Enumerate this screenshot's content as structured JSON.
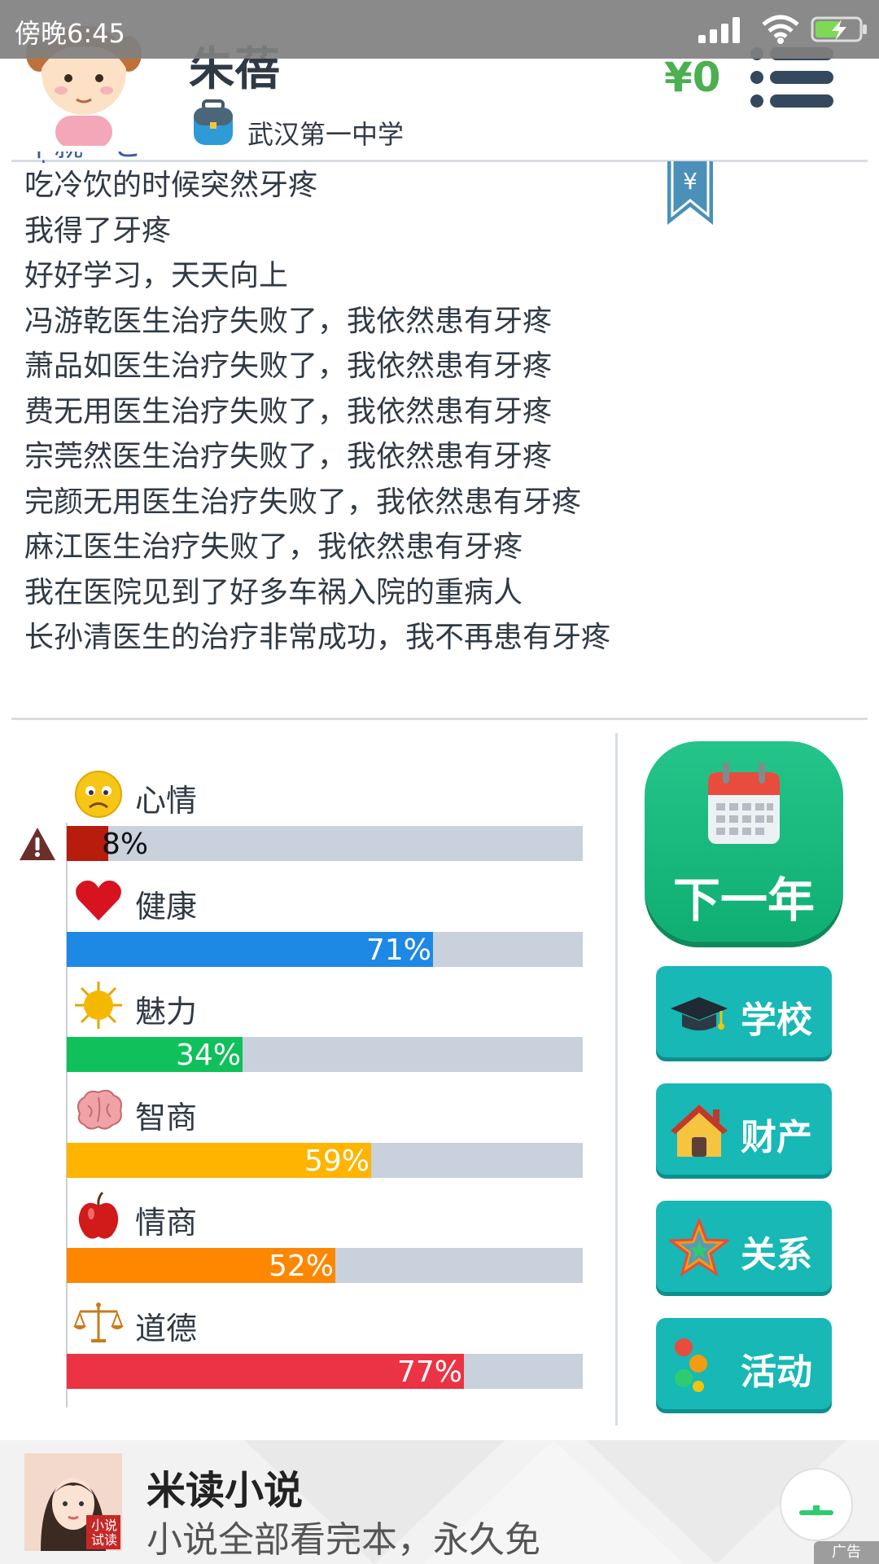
{
  "status_bar": {
    "time": "傍晚6:45"
  },
  "player": {
    "name": "朱蓓",
    "school": "武汉第一中学",
    "money": "¥0"
  },
  "log": {
    "cut_line": "中就「と吵",
    "lines": [
      "吃冷饮的时候突然牙疼",
      "我得了牙疼",
      "好好学习，天天向上",
      "冯游乾医生治疗失败了，我依然患有牙疼",
      "萧品如医生治疗失败了，我依然患有牙疼",
      "费无用医生治疗失败了，我依然患有牙疼",
      "宗莞然医生治疗失败了，我依然患有牙疼",
      "完颜无用医生治疗失败了，我依然患有牙疼",
      "麻江医生治疗失败了，我依然患有牙疼",
      "我在医院见到了好多车祸入院的重病人",
      "长孙清医生的治疗非常成功，我不再患有牙疼"
    ]
  },
  "bookmark_symbol": "¥",
  "stats": [
    {
      "key": "mood",
      "label": "心情",
      "icon": "sad-face-icon",
      "value": 8,
      "pct": "8%",
      "color": "#b71c0c",
      "warning": true
    },
    {
      "key": "health",
      "label": "健康",
      "icon": "heart-icon",
      "value": 71,
      "pct": "71%",
      "color": "#1e88e5"
    },
    {
      "key": "charm",
      "label": "魅力",
      "icon": "sun-icon",
      "value": 34,
      "pct": "34%",
      "color": "#10c05a"
    },
    {
      "key": "iq",
      "label": "智商",
      "icon": "brain-icon",
      "value": 59,
      "pct": "59%",
      "color": "#ffb400"
    },
    {
      "key": "eq",
      "label": "情商",
      "icon": "apple-icon",
      "value": 52,
      "pct": "52%",
      "color": "#ff8700"
    },
    {
      "key": "moral",
      "label": "道德",
      "icon": "scales-icon",
      "value": 77,
      "pct": "77%",
      "color": "#ec3344"
    }
  ],
  "actions": {
    "next_year": "下一年",
    "school": "学校",
    "assets": "财产",
    "relations": "关系",
    "activities": "活动"
  },
  "ad": {
    "title": "米读小说",
    "description": "小说全部看完本，永久免",
    "thumb_tag": "小说试读",
    "badge": "广告"
  }
}
